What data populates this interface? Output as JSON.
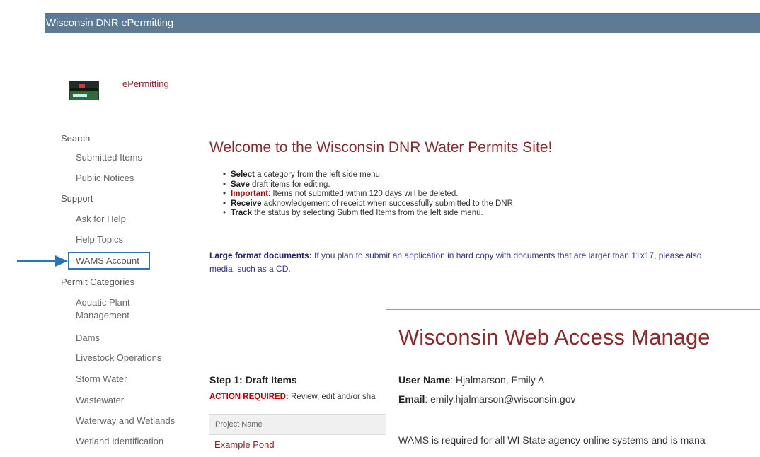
{
  "app": {
    "title": "Wisconsin DNR ePermitting",
    "brand_label": "ePermitting",
    "logo_icon": "wi-dnr-logo"
  },
  "sidebar": {
    "search": {
      "label": "Search",
      "items": [
        "Submitted Items",
        "Public Notices"
      ]
    },
    "support": {
      "label": "Support",
      "items": [
        "Ask for Help",
        "Help Topics",
        "WAMS Account"
      ]
    },
    "permit_categories": {
      "label": "Permit Categories",
      "items": [
        "Aquatic Plant Management",
        "Dams",
        "Livestock Operations",
        "Storm Water",
        "Wastewater",
        "Waterway and Wetlands",
        "Wetland Identification"
      ]
    }
  },
  "callout": {
    "arrow_icon": "arrow-right-icon",
    "color": "#2e75b6"
  },
  "main": {
    "welcome": "Welcome to the Wisconsin DNR Water Permits Site!",
    "bullets": [
      {
        "bold": "Select",
        "text": " a category from the left side menu."
      },
      {
        "bold": "Save",
        "text": " draft items for editing."
      },
      {
        "bold": "Important",
        "text": ": Items not submitted within 120 days will be deleted."
      },
      {
        "bold": "Receive",
        "text": " acknowledgement of receipt when successfully submitted to the DNR."
      },
      {
        "bold": "Track",
        "text": " the status by selecting Submitted Items from the left side menu."
      }
    ],
    "large_docs_label": "Large format documents:",
    "large_docs_text": " If you plan to submit an application in hard copy with documents that are larger than 11x17, please also",
    "large_docs_text2": "media, such as a CD.",
    "step1_title": "Step 1: Draft Items",
    "action_label": "ACTION REQUIRED:",
    "action_text": " Review, edit and/or sha",
    "table_header": "Project Name",
    "rows": [
      "Example Pond"
    ]
  },
  "wams_popup": {
    "title": "Wisconsin Web Access Manage",
    "user_label": "User Name",
    "user_value": ": Hjalmarson, Emily A",
    "email_label": "Email",
    "email_value": ": emily.hjalmarson@wisconsin.gov",
    "description": "WAMS is required for all WI State agency online systems and is mana"
  }
}
